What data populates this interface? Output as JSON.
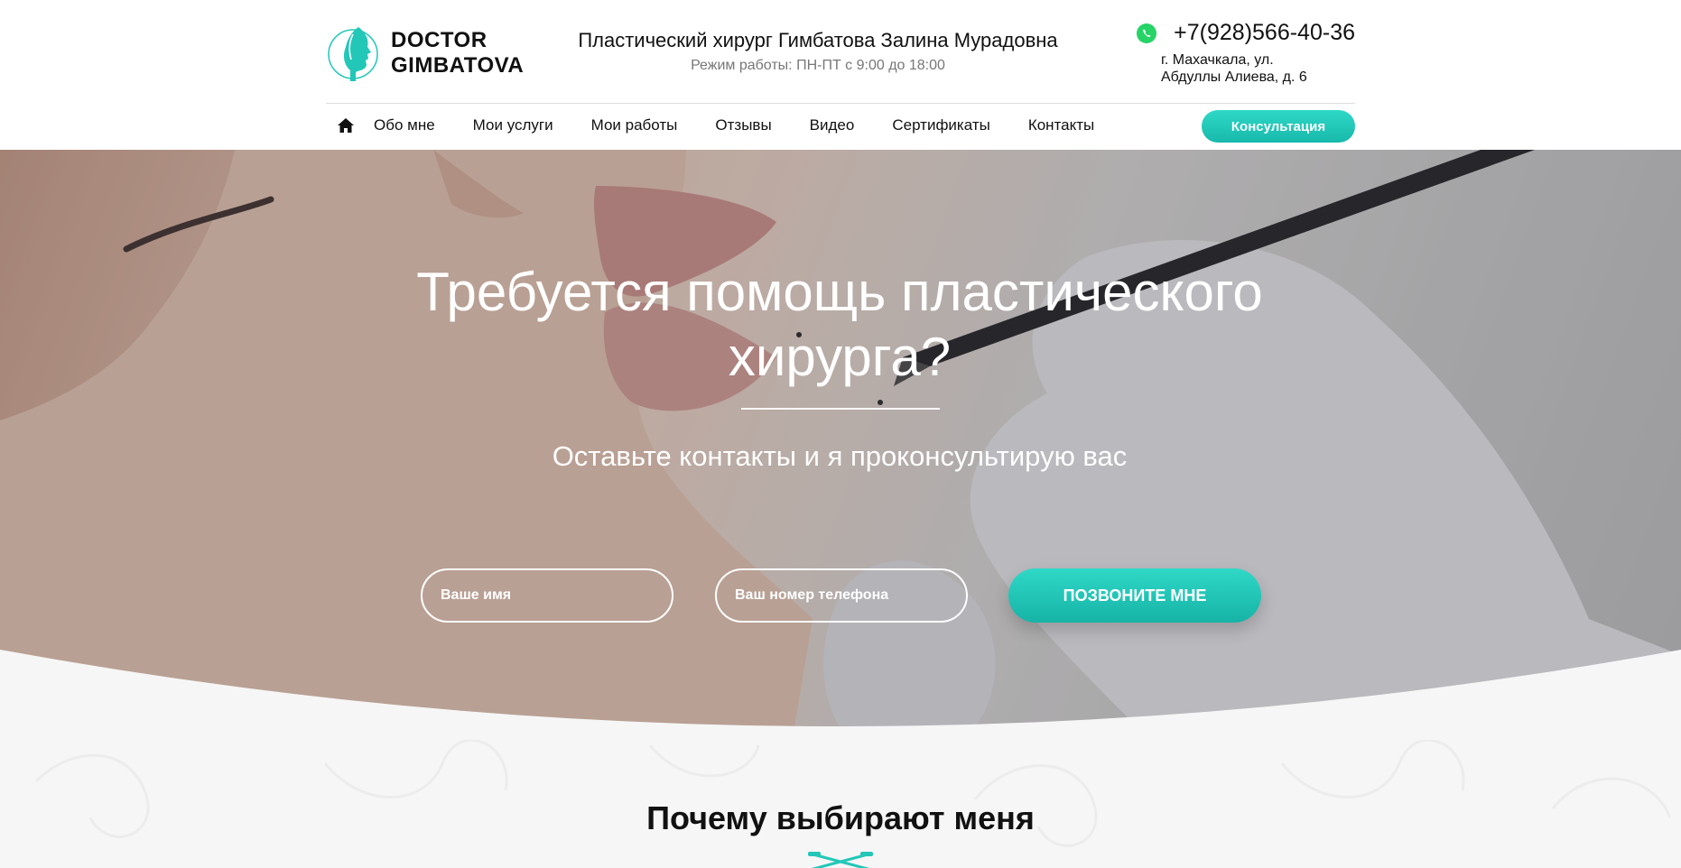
{
  "brand": {
    "line1": "DOCTOR",
    "line2": "GIMBATOVA",
    "accent_color": "#22c7b8"
  },
  "header": {
    "doctor_title": "Пластический хирург Гимбатова Залина Мурадовна",
    "work_hours": "Режим работы: ПН-ПТ с 9:00 до 18:00",
    "phone": "+7(928)566-40-36",
    "address_line1": "г. Махачкала, ул.",
    "address_line2": "Абдуллы Алиева, д. 6",
    "whatsapp_icon": "whatsapp-icon"
  },
  "nav": {
    "home_icon": "home-icon",
    "items": [
      {
        "label": "Обо мне"
      },
      {
        "label": "Мои услуги"
      },
      {
        "label": "Мои работы"
      },
      {
        "label": "Отзывы"
      },
      {
        "label": "Видео"
      },
      {
        "label": "Сертификаты"
      },
      {
        "label": "Контакты"
      }
    ],
    "consult_label": "Консультация"
  },
  "hero": {
    "title": "Требуется помощь пластического хирурга?",
    "subtitle": "Оставьте контакты и я проконсультирую вас",
    "name_placeholder": "Ваше имя",
    "phone_placeholder": "Ваш номер телефона",
    "call_button": "ПОЗВОНИТЕ МНЕ"
  },
  "why": {
    "title": "Почему выбирают меня",
    "icon": "scalpel-icon"
  }
}
